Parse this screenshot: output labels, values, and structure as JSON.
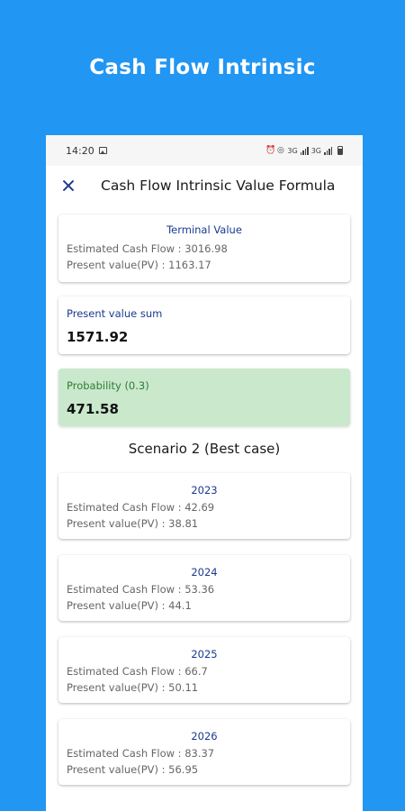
{
  "promo": {
    "title": "Cash Flow Intrinsic"
  },
  "status_bar": {
    "time": "14:20",
    "icons": [
      "gallery-icon",
      "alarm-icon",
      "wifi-icon",
      "signal-icon",
      "signal-icon",
      "battery-icon"
    ],
    "network_labels": [
      "3G",
      "3G"
    ]
  },
  "app_bar": {
    "close_icon": "close-icon",
    "title": "Cash Flow Intrinsic Value Formula"
  },
  "terminal_value": {
    "heading": "Terminal Value",
    "cash_flow": "Estimated Cash Flow : 3016.98",
    "present_value": "Present value(PV) : 1163.17"
  },
  "present_value_sum": {
    "label": "Present value sum",
    "value": "1571.92"
  },
  "probability": {
    "label": "Probability (0.3)",
    "value": "471.58"
  },
  "scenario": {
    "title": "Scenario 2 (Best case)",
    "years": [
      {
        "year": "2023",
        "cash_flow": "Estimated Cash Flow : 42.69",
        "present_value": "Present value(PV) : 38.81"
      },
      {
        "year": "2024",
        "cash_flow": "Estimated Cash Flow : 53.36",
        "present_value": "Present value(PV) : 44.1"
      },
      {
        "year": "2025",
        "cash_flow": "Estimated Cash Flow : 66.7",
        "present_value": "Present value(PV) : 50.11"
      },
      {
        "year": "2026",
        "cash_flow": "Estimated Cash Flow : 83.37",
        "present_value": "Present value(PV) : 56.95"
      }
    ]
  },
  "colors": {
    "background": "#2196f3",
    "accent_text": "#1a3a8f",
    "probability_card": "#c9e8cc",
    "probability_text": "#2e7d32"
  }
}
